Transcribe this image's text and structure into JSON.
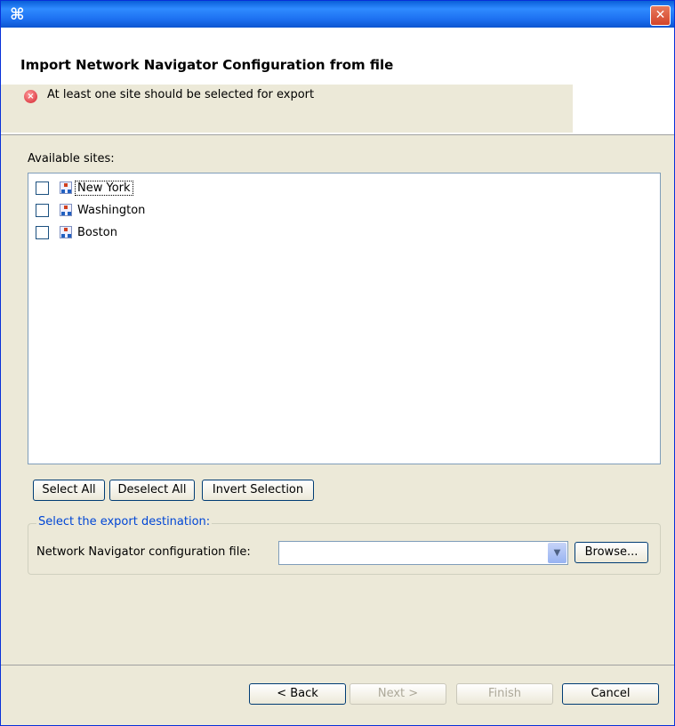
{
  "window": {
    "app_icon": "⌘",
    "close_glyph": "✕"
  },
  "banner": {
    "title": "Import Network Navigator Configuration from file",
    "message": "At least one site should be selected for export",
    "message_icon": "error-icon"
  },
  "sites": {
    "label": "Available sites:",
    "items": [
      {
        "label": "New York",
        "checked": false,
        "focused": true
      },
      {
        "label": "Washington",
        "checked": false,
        "focused": false
      },
      {
        "label": "Boston",
        "checked": false,
        "focused": false
      }
    ]
  },
  "selection_buttons": {
    "select_all": "Select All",
    "deselect_all": "Deselect All",
    "invert_selection": "Invert Selection"
  },
  "destination": {
    "group_label": "Select the export destination:",
    "field_label": "Network Navigator configuration file:",
    "field_value": "",
    "browse": "Browse..."
  },
  "footer": {
    "back": "< Back",
    "next": "Next >",
    "finish": "Finish",
    "cancel": "Cancel"
  },
  "colors": {
    "titlebar": "#1c6ff0",
    "dialog_bg": "#ece9d8",
    "legend_text": "#0046d5",
    "error": "#d3212c"
  }
}
